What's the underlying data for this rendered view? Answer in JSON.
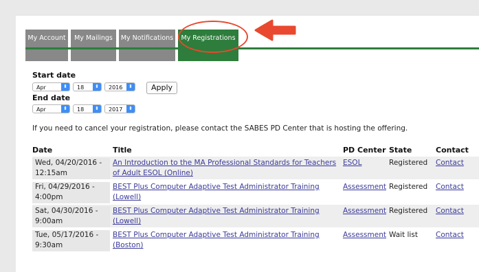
{
  "tabs": [
    {
      "label": "My Account"
    },
    {
      "label": "My Mailings"
    },
    {
      "label": "My Notifications"
    },
    {
      "label": "My Registrations",
      "active": true
    }
  ],
  "annotation_color": "#e8492f",
  "accent_color": "#2e7d3c",
  "filters": {
    "start_label": "Start date",
    "start": {
      "month": "Apr",
      "day": "18",
      "year": "2016"
    },
    "end_label": "End date",
    "end": {
      "month": "Apr",
      "day": "18",
      "year": "2017"
    },
    "apply_label": "Apply"
  },
  "notice": "If you need to cancel your registration, please contact the SABES PD Center that is hosting the offering.",
  "table": {
    "headers": {
      "date": "Date",
      "title": "Title",
      "center": "PD Center",
      "state": "State",
      "contact": "Contact"
    },
    "rows": [
      {
        "date1": "Wed, 04/20/2016 -",
        "date2": "12:15am",
        "title1": "An Introduction to the MA Professional Standards for Teachers",
        "title2": "of Adult ESOL (Online)",
        "center": "ESOL",
        "state": "Registered",
        "contact": "Contact"
      },
      {
        "date1": "Fri, 04/29/2016 -",
        "date2": "4:00pm",
        "title1": "BEST Plus Computer Adaptive Test Administrator Training",
        "title2": "(Lowell)",
        "center": "Assessment",
        "state": "Registered",
        "contact": "Contact"
      },
      {
        "date1": "Sat, 04/30/2016 -",
        "date2": "9:00am",
        "title1": "BEST Plus Computer Adaptive Test Administrator Training",
        "title2": "(Lowell)",
        "center": "Assessment",
        "state": "Registered",
        "contact": "Contact"
      },
      {
        "date1": "Tue, 05/17/2016 -",
        "date2": "9:30am",
        "title1": "BEST Plus Computer Adaptive Test Administrator Training",
        "title2": "(Boston)",
        "center": "Assessment",
        "state": "Wait list",
        "contact": "Contact"
      }
    ]
  }
}
